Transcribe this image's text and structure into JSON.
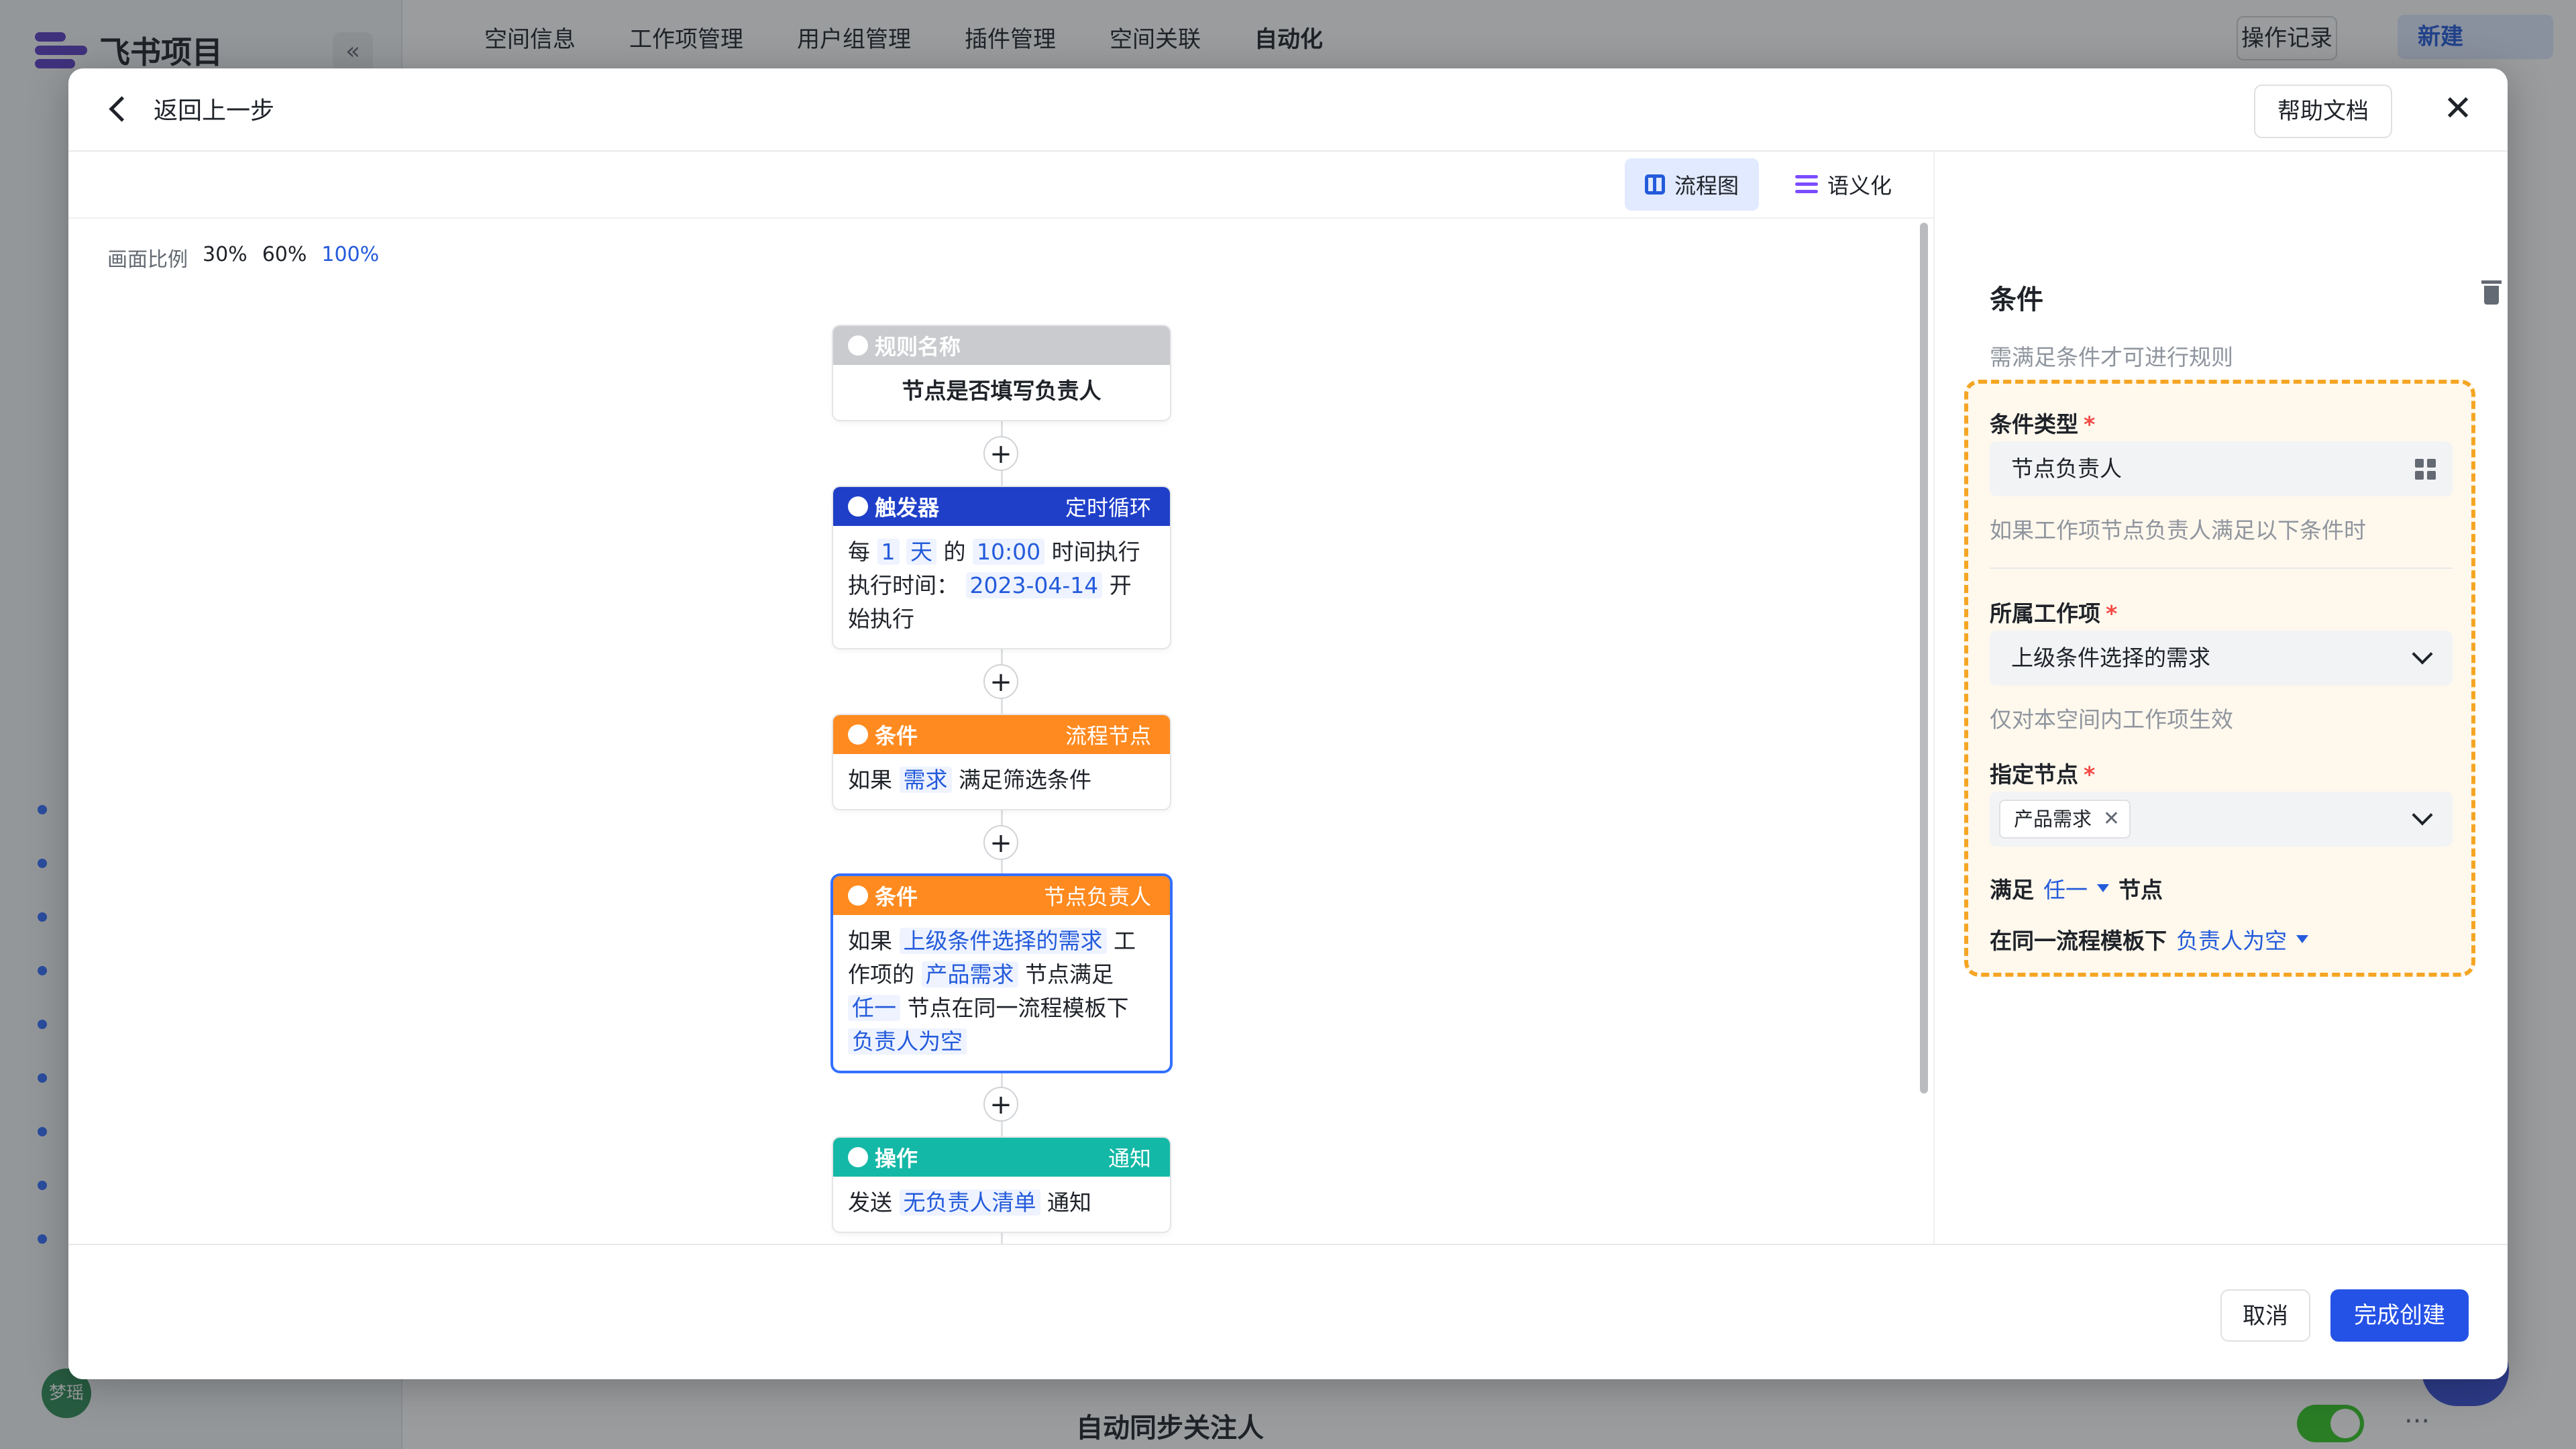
{
  "app": {
    "logo_text": "飞书项目",
    "collapse_glyph": "«",
    "top_tabs": [
      "空间信息",
      "工作项管理",
      "用户组管理",
      "插件管理",
      "空间关联",
      "自动化"
    ],
    "active_tab": "自动化",
    "op_log": "操作记录",
    "new_button": "新建",
    "avatar_text": "梦瑶",
    "bottom_label": "自动同步关注人",
    "more_glyph": "···"
  },
  "modal": {
    "back_label": "返回上一步",
    "help_label": "帮助文档",
    "close_glyph": "✕",
    "view_tabs": {
      "flow": "流程图",
      "semantic": "语义化"
    },
    "zoom": {
      "label": "画面比例",
      "options": [
        "30%",
        "60%",
        "100%"
      ],
      "active": "100%"
    },
    "flow": {
      "rule": {
        "header": "规则名称",
        "title": "节点是否填写负责人"
      },
      "trigger": {
        "header": "触发器",
        "type": "定时循环",
        "t1": "每",
        "v1": "1",
        "v2": "天",
        "t2": "的",
        "v3": "10:00",
        "t3": "时间执行",
        "t4": "执行时间：",
        "v4": "2023-04-14",
        "t5": "开",
        "t6": "始执行"
      },
      "cond1": {
        "header": "条件",
        "type": "流程节点",
        "t1": "如果",
        "v1": "需求",
        "t2": "满足筛选条件"
      },
      "cond2": {
        "header": "条件",
        "type": "节点负责人",
        "t1": "如果",
        "v1": "上级条件选择的需求",
        "t2": "工",
        "t3": "作项的",
        "v2": "产品需求",
        "t4": "节点满足",
        "v3": "任一",
        "t5": "节点在同一流程模板下",
        "v4": "负责人为空"
      },
      "action": {
        "header": "操作",
        "type": "通知",
        "t1": "发送",
        "v1": "无负责人清单",
        "t2": "通知"
      },
      "plus_glyph": "+"
    },
    "panel": {
      "title": "条件",
      "desc": "需满足条件才可进行规则",
      "cond_type": {
        "label": "条件类型",
        "value": "节点负责人",
        "hint": "如果工作项节点负责人满足以下条件时"
      },
      "work_item": {
        "label": "所属工作项",
        "value": "上级条件选择的需求",
        "hint": "仅对本空间内工作项生效"
      },
      "node": {
        "label": "指定节点",
        "chip": "产品需求",
        "chip_close": "✕"
      },
      "satisfy": {
        "t1": "满足",
        "v1": "任一",
        "t2": "节点"
      },
      "template": {
        "t1": "在同一流程模板下",
        "v1": "负责人为空"
      },
      "required_mark": "*"
    },
    "footer": {
      "cancel": "取消",
      "confirm": "完成创建"
    }
  },
  "colors": {
    "accent": "#245bdb",
    "trigger_header": "#1f3fc9",
    "condition_header": "#ff8a1f",
    "action_header": "#14b8a6",
    "dashed_border": "#f5a524",
    "primary_button": "#2552e6"
  }
}
